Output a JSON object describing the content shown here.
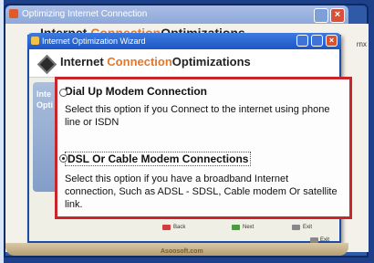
{
  "background_window": {
    "title": "Optimizing Internet Connection",
    "heading_prefix": "Internet",
    "heading_accent": "Connection",
    "heading_suffix": "Optimizations",
    "side_text": "rnx"
  },
  "wizard": {
    "title": "Internet Optimization Wizard",
    "heading_prefix": "Internet",
    "heading_accent": "Connection",
    "heading_suffix": "Optimizations",
    "side_panel_text": "Inte",
    "side_panel_text2": "Opti"
  },
  "options": [
    {
      "title": "Dial Up Modem Connection",
      "description": "Select this option if you Connect to the internet using phone line or ISDN",
      "selected": false
    },
    {
      "title": "DSL Or Cable Modem Connections",
      "description": "Select this option if you have a  broadband Internet connection, Such as ADSL - SDSL, Cable modem Or satellite link.",
      "selected": true
    }
  ],
  "footer": {
    "back_label": "Back",
    "next_label": "Next",
    "exit_wizard_label": "Exit",
    "exit_label": "Exit",
    "site_label": "Asoosoft.com"
  },
  "colors": {
    "accent_orange": "#e2782a",
    "highlight_red": "#c8262a",
    "title_blue": "#1e56c4"
  }
}
